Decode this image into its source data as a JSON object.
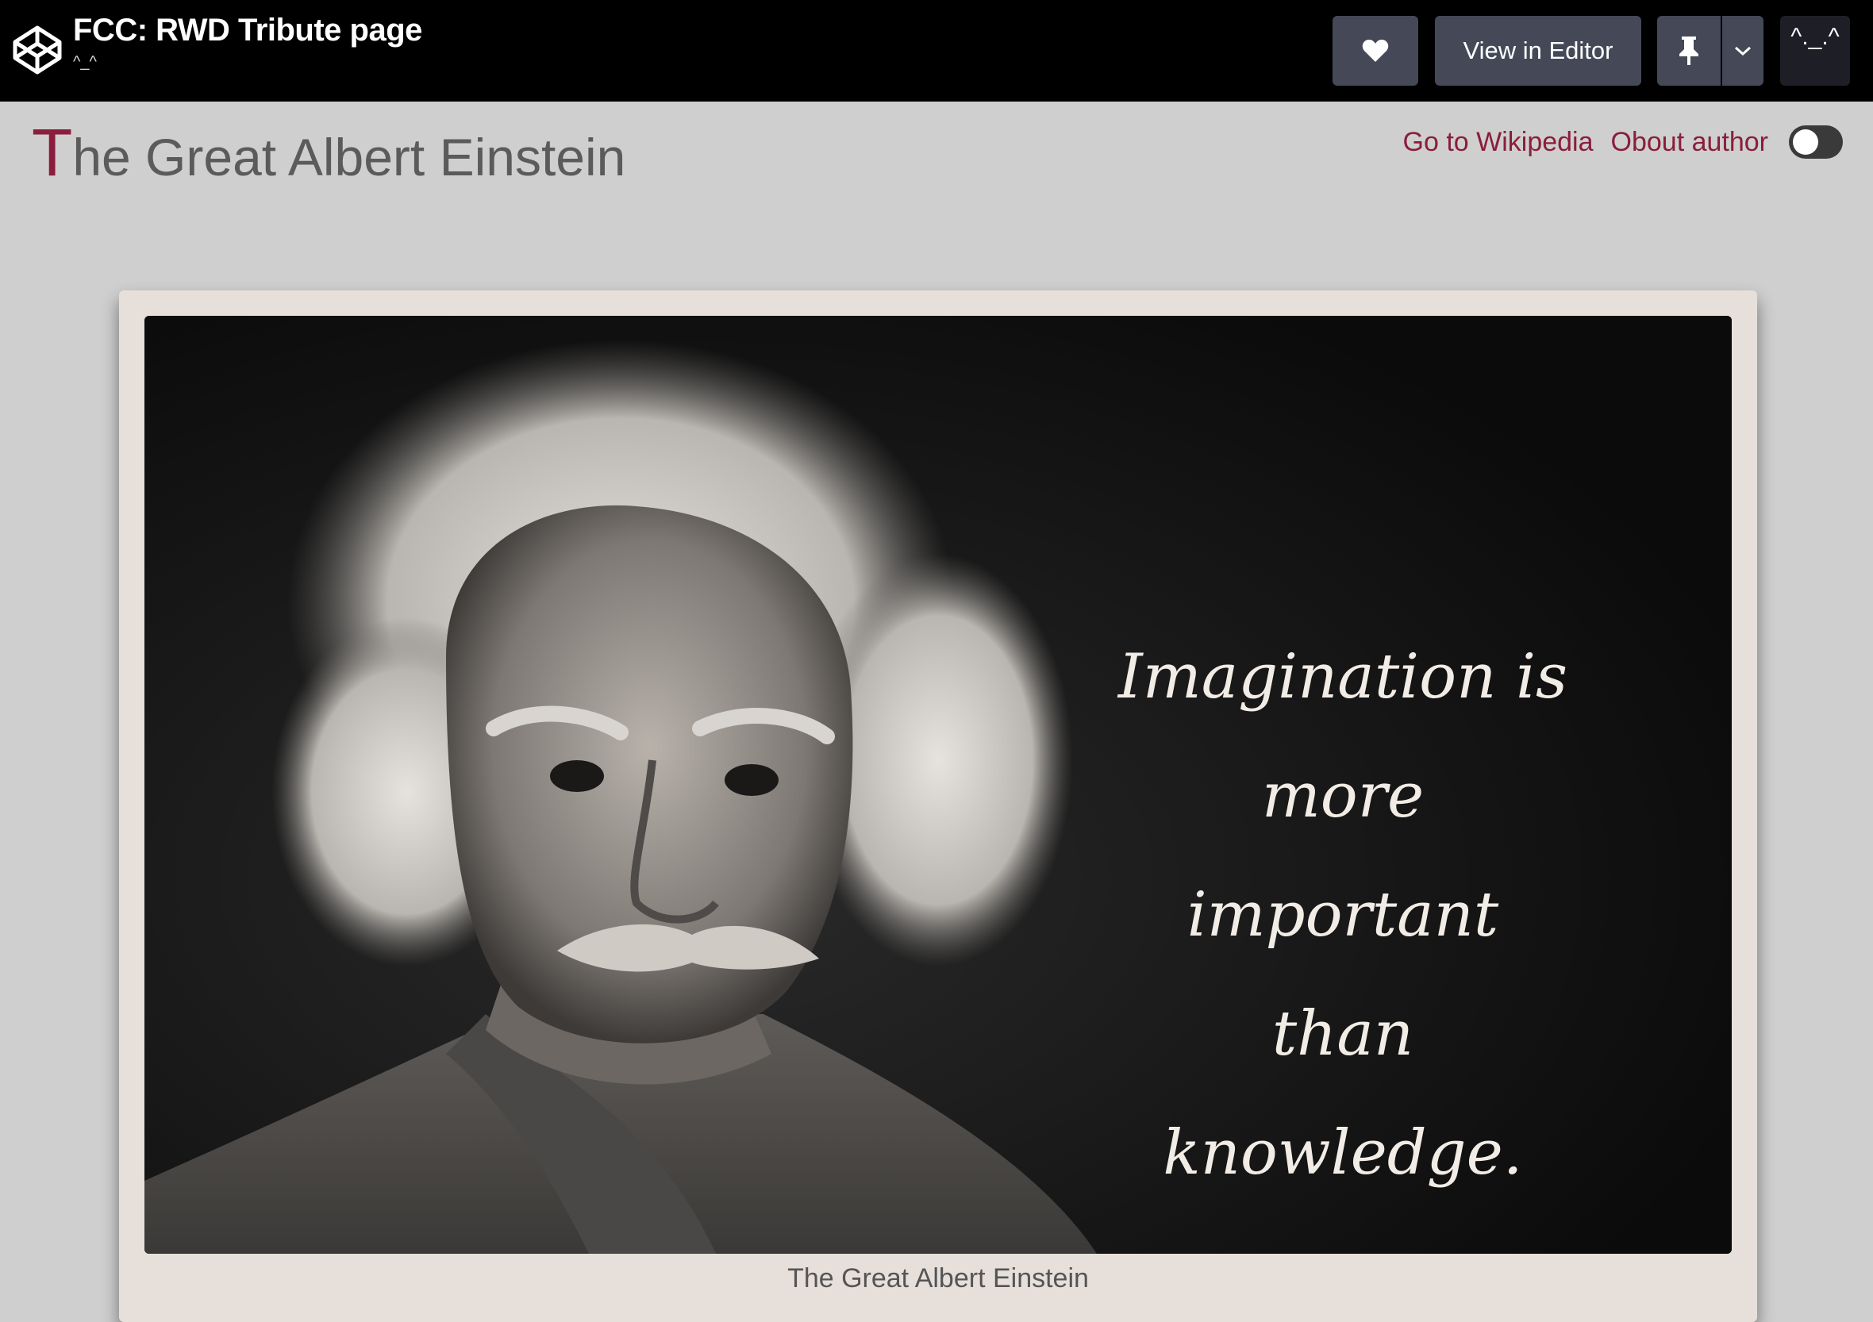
{
  "topbar": {
    "pen_title": "FCC: RWD Tribute page",
    "author": "^_^",
    "buttons": {
      "heart_icon": "heart-icon",
      "view_in_editor": "View in Editor",
      "pin_icon": "pin-icon",
      "caret_icon": "chevron-down-icon",
      "profile_face": "^._.^"
    }
  },
  "header": {
    "title_first_letter": "T",
    "title_rest": "he Great Albert Einstein",
    "nav": {
      "wikipedia": "Go to Wikipedia",
      "about": "Obout author"
    }
  },
  "figure": {
    "quote_lines": [
      "Imagination is",
      "more important",
      "than knowledge."
    ],
    "caption": "The Great Albert Einstein"
  },
  "colors": {
    "accent": "#8a1e3c",
    "page_bg": "#cfcfcf",
    "card_bg": "#e7e0da",
    "topbar_bg": "#000000",
    "button_bg": "#444857"
  }
}
